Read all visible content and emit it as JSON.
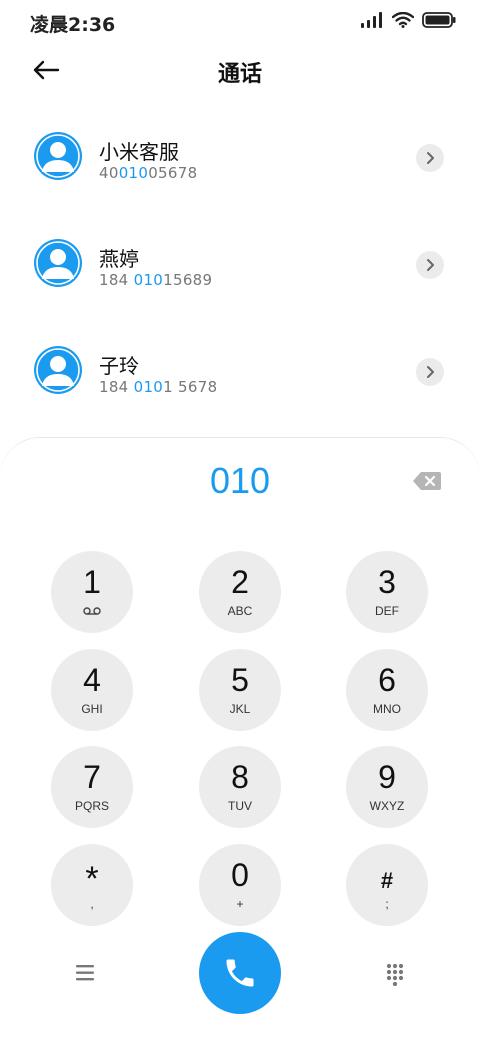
{
  "status_bar": {
    "time": "凌晨2:36",
    "icons": [
      "signal-icon",
      "wifi-icon",
      "battery-icon"
    ]
  },
  "header": {
    "title": "通话",
    "back_icon": "back-arrow-icon"
  },
  "contacts": [
    {
      "name": "小米客服",
      "number_pre": "40",
      "number_match": "010",
      "number_post": "05678"
    },
    {
      "name": "燕婷",
      "number_pre": "184 ",
      "number_match": "010",
      "number_post": "15689"
    },
    {
      "name": "子玲",
      "number_pre": "184 ",
      "number_match": "010",
      "number_post": "1 5678"
    }
  ],
  "dialpad": {
    "input": "010",
    "keys": [
      {
        "digit": "1",
        "sub": ""
      },
      {
        "digit": "2",
        "sub": "ABC"
      },
      {
        "digit": "3",
        "sub": "DEF"
      },
      {
        "digit": "4",
        "sub": "GHI"
      },
      {
        "digit": "5",
        "sub": "JKL"
      },
      {
        "digit": "6",
        "sub": "MNO"
      },
      {
        "digit": "7",
        "sub": "PQRS"
      },
      {
        "digit": "8",
        "sub": "TUV"
      },
      {
        "digit": "9",
        "sub": "WXYZ"
      },
      {
        "digit": "*",
        "sub": ","
      },
      {
        "digit": "0",
        "sub": "+"
      },
      {
        "digit": "#",
        "sub": ";"
      }
    ]
  },
  "colors": {
    "accent": "#1a9bf0",
    "key_bg": "#ececec",
    "secondary_text": "#777777"
  }
}
